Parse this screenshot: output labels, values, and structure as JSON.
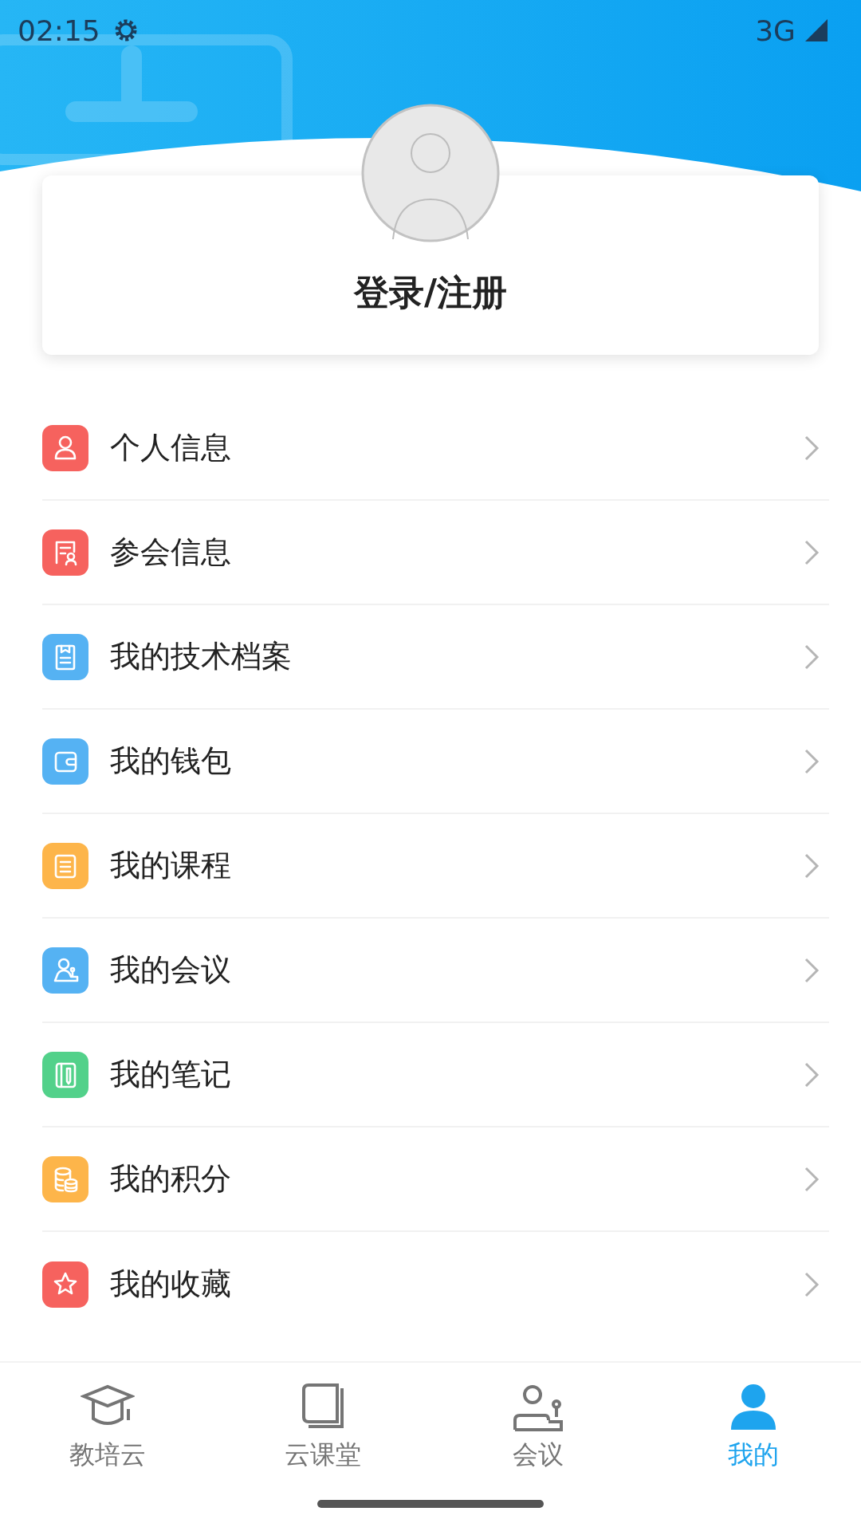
{
  "status_bar": {
    "time": "02:15",
    "network": "3G"
  },
  "profile": {
    "login_label": "登录/注册"
  },
  "menu": [
    {
      "label": "个人信息",
      "color": "#f6625e"
    },
    {
      "label": "参会信息",
      "color": "#f6625e"
    },
    {
      "label": "我的技术档案",
      "color": "#55b2f3"
    },
    {
      "label": "我的钱包",
      "color": "#55b2f3"
    },
    {
      "label": "我的课程",
      "color": "#fdb54a"
    },
    {
      "label": "我的会议",
      "color": "#55b2f3"
    },
    {
      "label": "我的笔记",
      "color": "#52d18a"
    },
    {
      "label": "我的积分",
      "color": "#fdb54a"
    },
    {
      "label": "我的收藏",
      "color": "#f6625e"
    }
  ],
  "tabs": [
    {
      "label": "教培云",
      "selected": false
    },
    {
      "label": "云课堂",
      "selected": false
    },
    {
      "label": "会议",
      "selected": false
    },
    {
      "label": "我的",
      "selected": true
    }
  ]
}
